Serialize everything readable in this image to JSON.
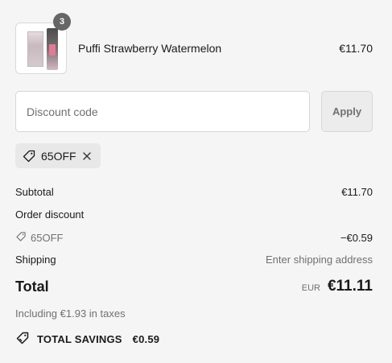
{
  "cart": {
    "item": {
      "name": "Puffi Strawberry Watermelon",
      "price": "€11.70",
      "quantity": "3"
    }
  },
  "discount": {
    "placeholder": "Discount code",
    "apply_label": "Apply",
    "applied_code": "65OFF"
  },
  "summary": {
    "subtotal_label": "Subtotal",
    "subtotal_value": "€11.70",
    "order_discount_label": "Order discount",
    "discount_code": "65OFF",
    "discount_value": "−€0.59",
    "shipping_label": "Shipping",
    "shipping_value": "Enter shipping address",
    "total_label": "Total",
    "total_currency": "EUR",
    "total_value": "€11.11",
    "tax_line": "Including €1.93 in taxes",
    "savings_label": "TOTAL SAVINGS",
    "savings_value": "€0.59"
  }
}
